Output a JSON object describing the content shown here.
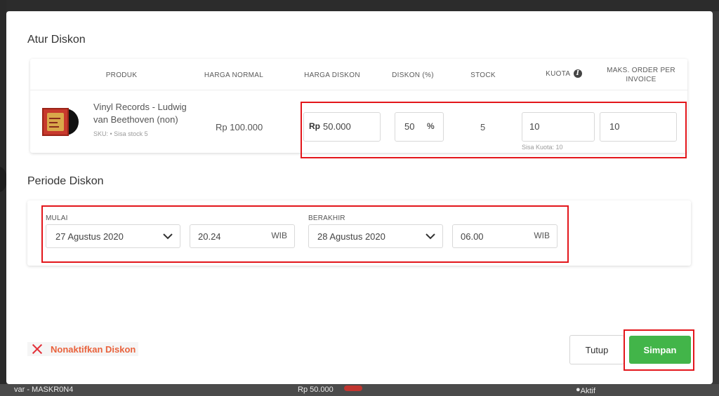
{
  "background": {
    "bottom_left_text": "var - MASKR0N4",
    "bottom_mid_text": "Rp 50.000",
    "bottom_right_text": "Aktif"
  },
  "atur_diskon": {
    "title": "Atur Diskon",
    "headers": {
      "produk": "PRODUK",
      "harga_normal": "HARGA NORMAL",
      "harga_diskon": "HARGA DISKON",
      "diskon_pct": "DISKON (%)",
      "stock": "STOCK",
      "kuota": "KUOTA",
      "maks_order_line1": "MAKS. ORDER PER",
      "maks_order_line2": "INVOICE"
    },
    "product": {
      "name": "Vinyl Records - Ludwig van Beethoven (non)",
      "sku_note": "SKU: • Sisa stock 5",
      "harga_normal": "Rp 100.000",
      "harga_diskon_prefix": "Rp",
      "harga_diskon_value": "50.000",
      "diskon_value": "50",
      "diskon_suffix": "%",
      "stock": "5",
      "kuota_value": "10",
      "kuota_hint": "Sisa Kuota: 10",
      "maks_order_value": "10"
    }
  },
  "periode_diskon": {
    "title": "Periode Diskon",
    "mulai_label": "MULAI",
    "mulai_date": "27 Agustus 2020",
    "mulai_time": "20.24",
    "mulai_tz": "WIB",
    "berakhir_label": "BERAKHIR",
    "berakhir_date": "28 Agustus 2020",
    "berakhir_time": "06.00",
    "berakhir_tz": "WIB"
  },
  "footer": {
    "disable_label": "Nonaktifkan Diskon",
    "tutup_label": "Tutup",
    "simpan_label": "Simpan"
  },
  "colors": {
    "primary_green": "#42b549",
    "danger_orange": "#e9623c",
    "highlight_red": "#e3161b"
  }
}
